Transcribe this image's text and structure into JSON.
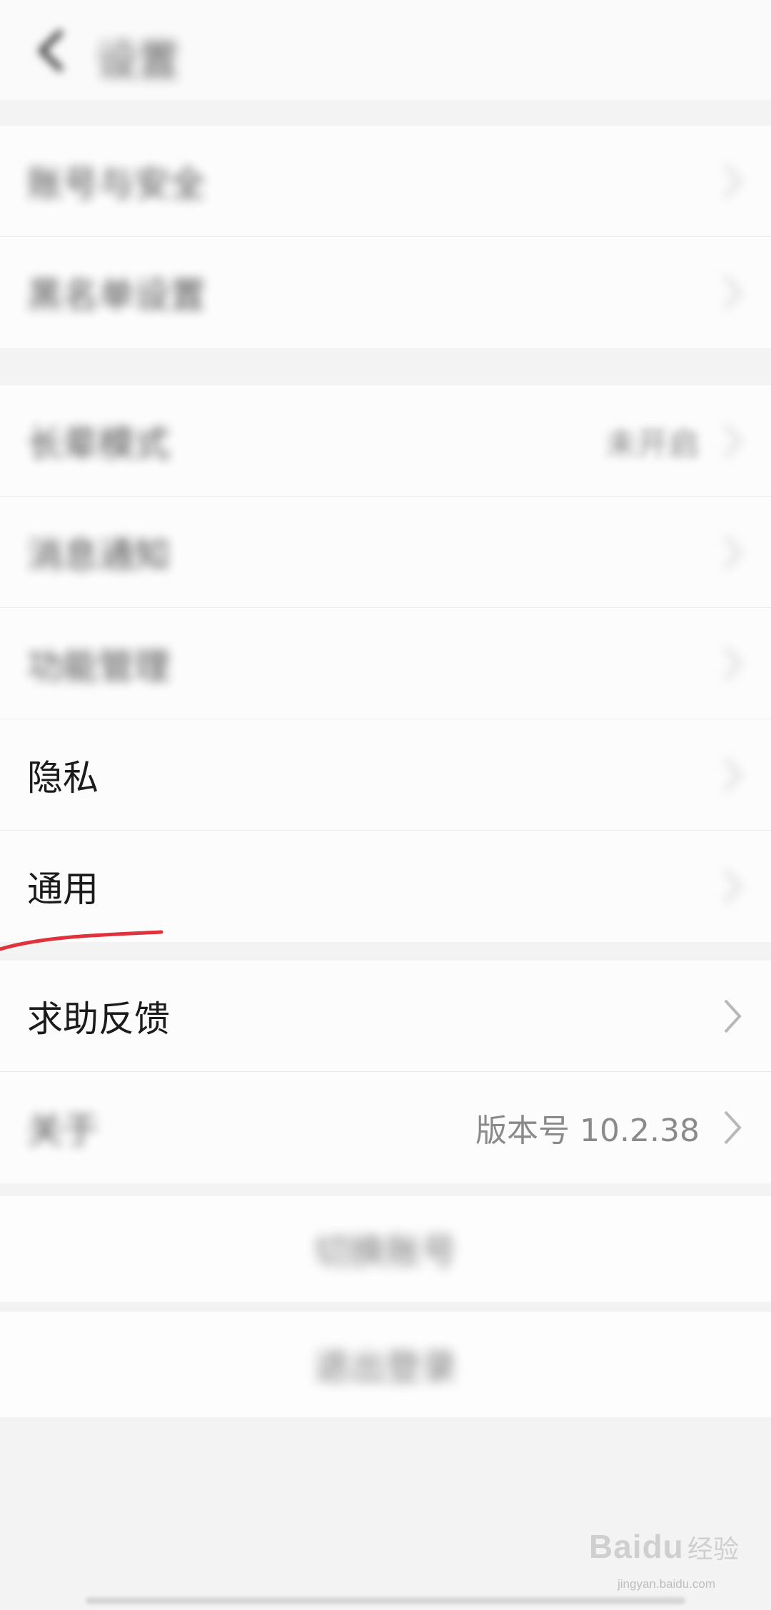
{
  "header": {
    "title": "设置"
  },
  "group1": [
    {
      "label": "账号与安全"
    },
    {
      "label": "黑名单设置"
    }
  ],
  "group2": [
    {
      "label": "长辈模式",
      "value": "未开启"
    },
    {
      "label": "消息通知"
    },
    {
      "label": "功能管理"
    },
    {
      "label": "隐私"
    },
    {
      "label": "通用"
    }
  ],
  "group3": [
    {
      "label": "求助反馈"
    },
    {
      "label": "关于",
      "value": "版本号 10.2.38"
    }
  ],
  "actions": {
    "switch_account": "切换账号",
    "logout": "退出登录"
  },
  "watermark": {
    "logo": "Baidu",
    "cn": "经验",
    "url": "jingyan.baidu.com"
  },
  "colors": {
    "annotation": "#e0323c",
    "background": "#f3f3f3"
  }
}
